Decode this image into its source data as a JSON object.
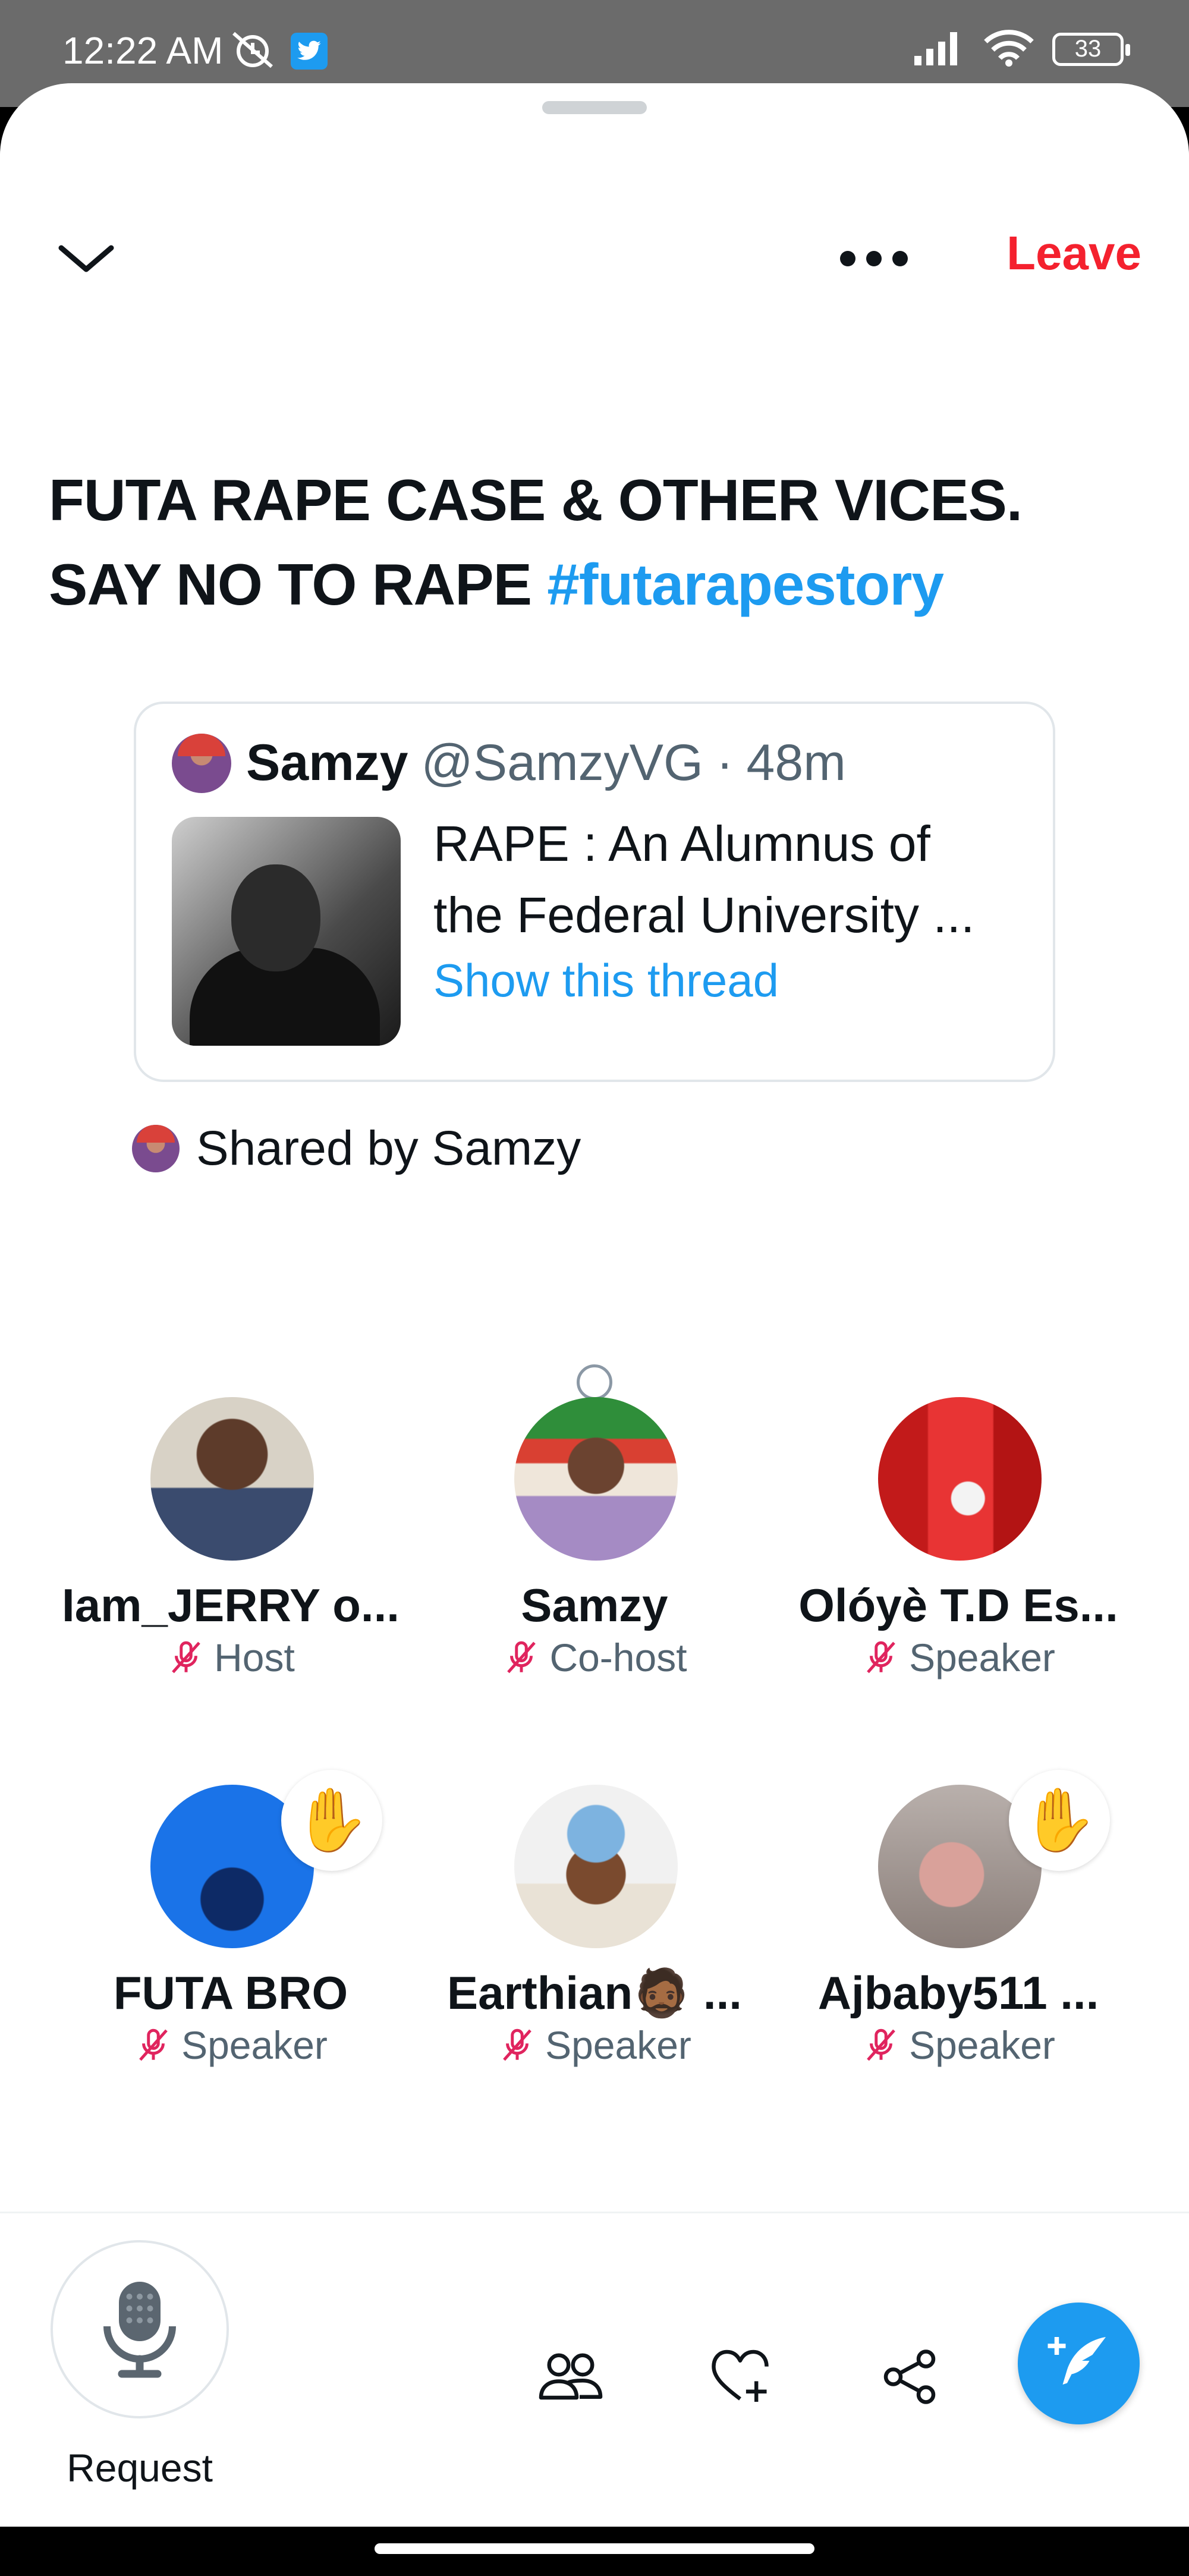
{
  "status_bar": {
    "time": "12:22 AM",
    "battery": "33"
  },
  "header": {
    "leave_label": "Leave"
  },
  "space": {
    "title_main": "FUTA RAPE CASE & OTHER VICES. SAY NO TO RAPE ",
    "title_hashtag": "#futarapestory"
  },
  "shared_tweet": {
    "author_name": "Samzy",
    "author_handle": "@SamzyVG",
    "separator": "·",
    "time_ago": "48m",
    "text_line1": "RAPE : An Alumnus of",
    "text_line2": "the Federal University ...",
    "show_thread": "Show this thread"
  },
  "shared_by": "Shared by Samzy",
  "participants": [
    {
      "name": "Iam_JERRY o...",
      "role": "Host",
      "raised_hand": false
    },
    {
      "name": "Samzy",
      "role": "Co-host",
      "raised_hand": false
    },
    {
      "name": "Olóyè T.D Es...",
      "role": "Speaker",
      "raised_hand": false
    },
    {
      "name": "FUTA BRO",
      "role": "Speaker",
      "raised_hand": true
    },
    {
      "name": "Earthian🧔🏾 ...",
      "role": "Speaker",
      "raised_hand": false
    },
    {
      "name": "Ajbaby511 ...",
      "role": "Speaker",
      "raised_hand": true
    }
  ],
  "bottom_bar": {
    "request_label": "Request"
  },
  "icons": {
    "raised_hand": "✋"
  },
  "colors": {
    "accent": "#1d9bf0",
    "leave": "#f4212e",
    "muted_mic": "#e0245e"
  }
}
